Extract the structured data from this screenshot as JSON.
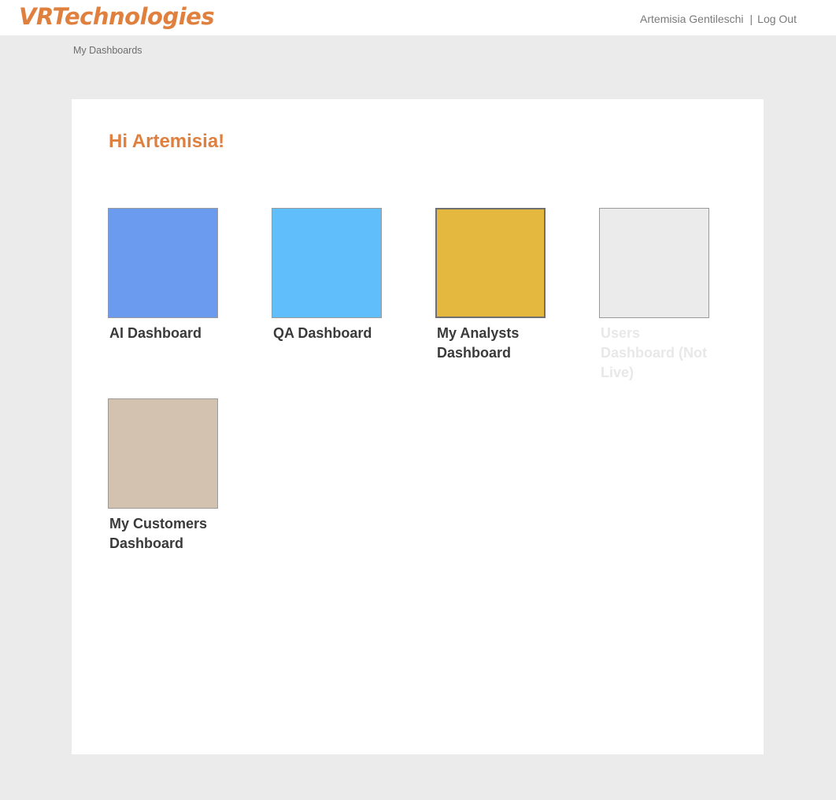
{
  "header": {
    "logo": "VRTechnologies",
    "user_name": "Artemisia Gentileschi",
    "separator": "|",
    "logout_label": "Log Out"
  },
  "breadcrumb": "My Dashboards",
  "greeting": "Hi Artemisia!",
  "dashboards": [
    {
      "label": "AI Dashboard",
      "color": "#6b9bef",
      "live": true
    },
    {
      "label": "QA Dashboard",
      "color": "#60befa",
      "live": true
    },
    {
      "label": "My Analysts Dashboard",
      "color": "#e4b83f",
      "live": true
    },
    {
      "label": "Users Dashboard (Not Live)",
      "color": "#ebebeb",
      "live": false
    },
    {
      "label": "My Customers Dashboard",
      "color": "#d4c2b1",
      "live": true
    }
  ]
}
